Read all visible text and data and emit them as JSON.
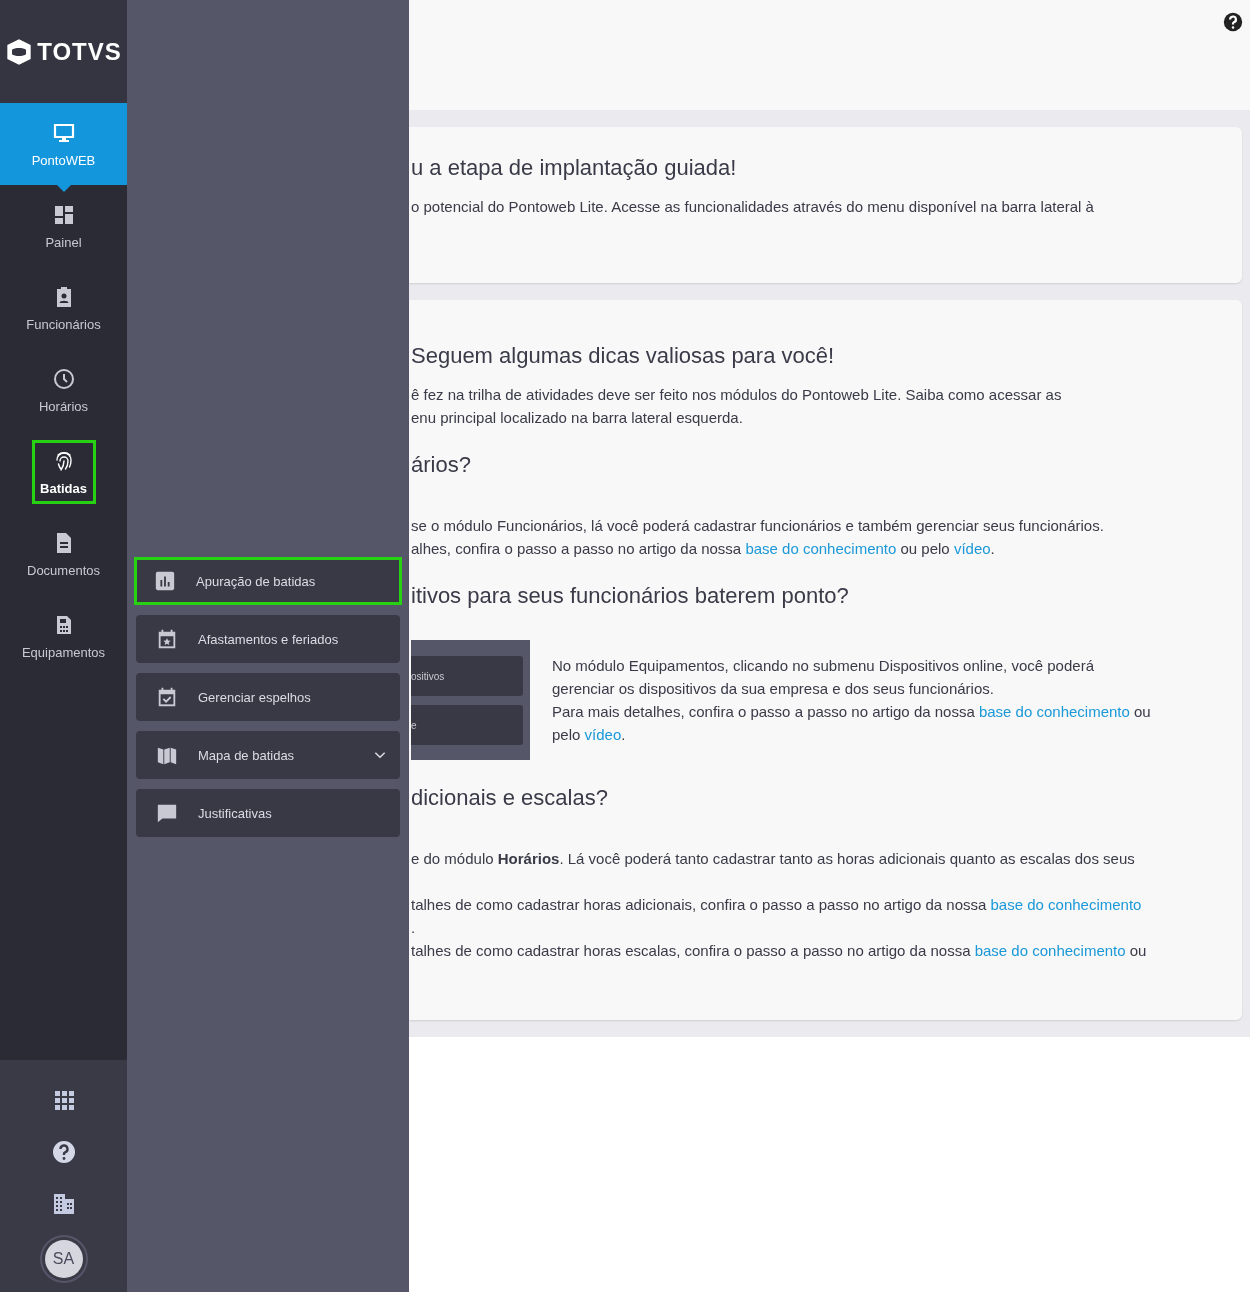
{
  "sidebar": {
    "logo": "TOTVS",
    "items": [
      {
        "label": "PontoWEB",
        "kind": "monitor",
        "selected": true,
        "highlighted": false
      },
      {
        "label": "Painel",
        "kind": "dashboard",
        "selected": false,
        "highlighted": false
      },
      {
        "label": "Funcionários",
        "kind": "badge",
        "selected": false,
        "highlighted": false
      },
      {
        "label": "Horários",
        "kind": "clock",
        "selected": false,
        "highlighted": false
      },
      {
        "label": "Batidas",
        "kind": "fingerprint",
        "selected": false,
        "highlighted": true
      },
      {
        "label": "Documentos",
        "kind": "document",
        "selected": false,
        "highlighted": false
      },
      {
        "label": "Equipamentos",
        "kind": "device",
        "selected": false,
        "highlighted": false
      }
    ],
    "avatar": "SA"
  },
  "submenu": {
    "items": [
      {
        "label": "Apuração de batidas",
        "kind": "chart",
        "highlighted": true,
        "expandable": false
      },
      {
        "label": "Afastamentos e feriados",
        "kind": "calendar-star",
        "highlighted": false,
        "expandable": false
      },
      {
        "label": "Gerenciar espelhos",
        "kind": "calendar-check",
        "highlighted": false,
        "expandable": false
      },
      {
        "label": "Mapa de batidas",
        "kind": "map",
        "highlighted": false,
        "expandable": true
      },
      {
        "label": "Justificativas",
        "kind": "comment",
        "highlighted": false,
        "expandable": false
      }
    ]
  },
  "cards": [
    {
      "blocks": [
        {
          "kind": "heading",
          "text": "u a etapa de implantação guiada!"
        },
        {
          "kind": "lines",
          "lines": [
            [
              {
                "kind": "text",
                "text": "o potencial do Pontoweb Lite. Acesse as funcionalidades através do menu disponível na barra lateral à"
              }
            ]
          ]
        }
      ]
    },
    {
      "blocks": [
        {
          "kind": "heading",
          "text": "Seguem algumas dicas valiosas para você!"
        },
        {
          "kind": "lines",
          "lines": [
            [
              {
                "kind": "text",
                "text": "ê fez na trilha de atividades deve ser feito nos módulos do Pontoweb Lite. Saiba como acessar as"
              }
            ],
            [
              {
                "kind": "text",
                "text": "enu principal localizado na barra lateral esquerda."
              }
            ]
          ]
        },
        {
          "kind": "heading",
          "text": "ários?"
        },
        {
          "kind": "lines",
          "lines": [
            [
              {
                "kind": "text",
                "text": "se o módulo Funcionários, lá você poderá cadastrar funcionários e também gerenciar seus funcionários."
              }
            ],
            [
              {
                "kind": "text",
                "text": "alhes, confira o passo a passo no artigo da nossa "
              },
              {
                "kind": "link",
                "text": "base do conhecimento"
              },
              {
                "kind": "text",
                "text": " ou pelo "
              },
              {
                "kind": "link",
                "text": "vídeo"
              },
              {
                "kind": "text",
                "text": "."
              }
            ]
          ]
        },
        {
          "kind": "heading",
          "text": "itivos para seus funcionários baterem ponto?"
        },
        {
          "kind": "figure",
          "items": [
            "ositivos",
            "e"
          ],
          "lines": [
            [
              {
                "kind": "text",
                "text": "No módulo Equipamentos, clicando no submenu Dispositivos online, você poderá"
              }
            ],
            [
              {
                "kind": "text",
                "text": "gerenciar os dispositivos da sua empresa e dos seus funcionários."
              }
            ],
            [
              {
                "kind": "text",
                "text": "Para mais detalhes, confira o passo a passo no artigo da nossa "
              },
              {
                "kind": "link",
                "text": "base do conhecimento"
              },
              {
                "kind": "text",
                "text": " ou"
              }
            ],
            [
              {
                "kind": "text",
                "text": "pelo "
              },
              {
                "kind": "link",
                "text": "vídeo"
              },
              {
                "kind": "text",
                "text": "."
              }
            ]
          ]
        },
        {
          "kind": "heading",
          "text": "dicionais e escalas?"
        },
        {
          "kind": "lines",
          "lines": [
            [
              {
                "kind": "text",
                "text": "e do módulo **Horários**. Lá você poderá tanto cadastrar tanto as horas adicionais quanto as escalas dos seus"
              }
            ]
          ]
        },
        {
          "kind": "lines",
          "lines": [
            [
              {
                "kind": "text",
                "text": "talhes de como cadastrar horas adicionais, confira o passo a passo no artigo da nossa "
              },
              {
                "kind": "link",
                "text": "base do conhecimento"
              }
            ],
            [
              {
                "kind": "text",
                "text": "."
              }
            ],
            [
              {
                "kind": "text",
                "text": "talhes de como cadastrar horas escalas, confira o passo a passo no artigo da nossa "
              },
              {
                "kind": "link",
                "text": "base do conhecimento"
              },
              {
                "kind": "text",
                "text": " ou"
              }
            ]
          ]
        }
      ]
    }
  ]
}
